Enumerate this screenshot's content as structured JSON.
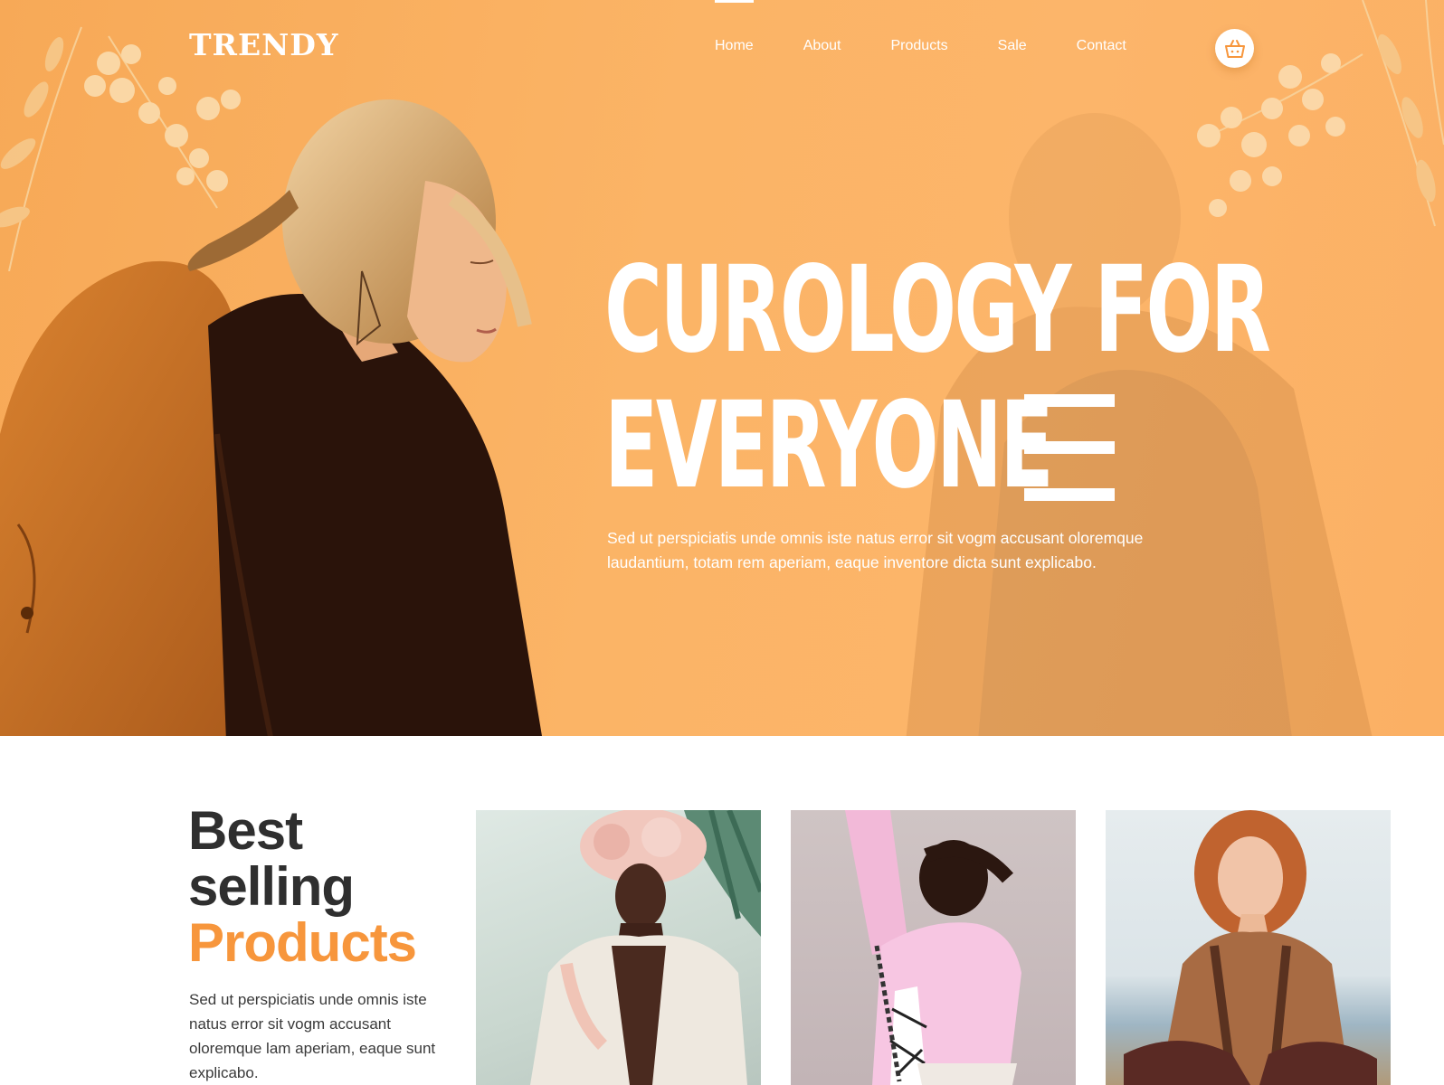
{
  "brand": {
    "logo": "TRENDY"
  },
  "nav": {
    "items": [
      {
        "label": "Home",
        "active": true
      },
      {
        "label": "About",
        "active": false
      },
      {
        "label": "Products",
        "active": false
      },
      {
        "label": "Sale",
        "active": false
      },
      {
        "label": "Contact",
        "active": false
      }
    ],
    "cart_icon": "basket-icon"
  },
  "hero": {
    "headline_line1": "CUROLOGY FOR",
    "headline_line2": "EVERYONE",
    "text": "Sed ut perspiciatis unde omnis iste natus error sit vogm accusant oloremque laudantium, totam rem aperiam, eaque inventore dicta sunt explicabo."
  },
  "best_selling": {
    "title_line1": "Best",
    "title_line2": "selling",
    "title_accent": "Products",
    "text": "Sed ut perspiciatis unde omnis iste natus error sit vogm accusant oloremque lam aperiam, eaque sunt explicabo."
  },
  "colors": {
    "hero_orange": "#fbb064",
    "accent": "#f7963c",
    "heading_dark": "#2f2f2f"
  }
}
